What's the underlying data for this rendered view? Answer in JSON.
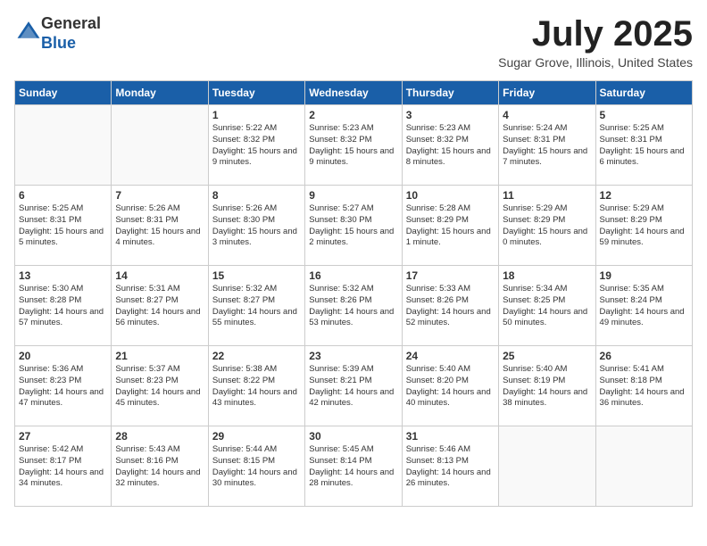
{
  "logo": {
    "line1": "General",
    "line2": "Blue"
  },
  "title": "July 2025",
  "location": "Sugar Grove, Illinois, United States",
  "weekdays": [
    "Sunday",
    "Monday",
    "Tuesday",
    "Wednesday",
    "Thursday",
    "Friday",
    "Saturday"
  ],
  "weeks": [
    [
      {
        "day": "",
        "info": ""
      },
      {
        "day": "",
        "info": ""
      },
      {
        "day": "1",
        "info": "Sunrise: 5:22 AM\nSunset: 8:32 PM\nDaylight: 15 hours and 9 minutes."
      },
      {
        "day": "2",
        "info": "Sunrise: 5:23 AM\nSunset: 8:32 PM\nDaylight: 15 hours and 9 minutes."
      },
      {
        "day": "3",
        "info": "Sunrise: 5:23 AM\nSunset: 8:32 PM\nDaylight: 15 hours and 8 minutes."
      },
      {
        "day": "4",
        "info": "Sunrise: 5:24 AM\nSunset: 8:31 PM\nDaylight: 15 hours and 7 minutes."
      },
      {
        "day": "5",
        "info": "Sunrise: 5:25 AM\nSunset: 8:31 PM\nDaylight: 15 hours and 6 minutes."
      }
    ],
    [
      {
        "day": "6",
        "info": "Sunrise: 5:25 AM\nSunset: 8:31 PM\nDaylight: 15 hours and 5 minutes."
      },
      {
        "day": "7",
        "info": "Sunrise: 5:26 AM\nSunset: 8:31 PM\nDaylight: 15 hours and 4 minutes."
      },
      {
        "day": "8",
        "info": "Sunrise: 5:26 AM\nSunset: 8:30 PM\nDaylight: 15 hours and 3 minutes."
      },
      {
        "day": "9",
        "info": "Sunrise: 5:27 AM\nSunset: 8:30 PM\nDaylight: 15 hours and 2 minutes."
      },
      {
        "day": "10",
        "info": "Sunrise: 5:28 AM\nSunset: 8:29 PM\nDaylight: 15 hours and 1 minute."
      },
      {
        "day": "11",
        "info": "Sunrise: 5:29 AM\nSunset: 8:29 PM\nDaylight: 15 hours and 0 minutes."
      },
      {
        "day": "12",
        "info": "Sunrise: 5:29 AM\nSunset: 8:29 PM\nDaylight: 14 hours and 59 minutes."
      }
    ],
    [
      {
        "day": "13",
        "info": "Sunrise: 5:30 AM\nSunset: 8:28 PM\nDaylight: 14 hours and 57 minutes."
      },
      {
        "day": "14",
        "info": "Sunrise: 5:31 AM\nSunset: 8:27 PM\nDaylight: 14 hours and 56 minutes."
      },
      {
        "day": "15",
        "info": "Sunrise: 5:32 AM\nSunset: 8:27 PM\nDaylight: 14 hours and 55 minutes."
      },
      {
        "day": "16",
        "info": "Sunrise: 5:32 AM\nSunset: 8:26 PM\nDaylight: 14 hours and 53 minutes."
      },
      {
        "day": "17",
        "info": "Sunrise: 5:33 AM\nSunset: 8:26 PM\nDaylight: 14 hours and 52 minutes."
      },
      {
        "day": "18",
        "info": "Sunrise: 5:34 AM\nSunset: 8:25 PM\nDaylight: 14 hours and 50 minutes."
      },
      {
        "day": "19",
        "info": "Sunrise: 5:35 AM\nSunset: 8:24 PM\nDaylight: 14 hours and 49 minutes."
      }
    ],
    [
      {
        "day": "20",
        "info": "Sunrise: 5:36 AM\nSunset: 8:23 PM\nDaylight: 14 hours and 47 minutes."
      },
      {
        "day": "21",
        "info": "Sunrise: 5:37 AM\nSunset: 8:23 PM\nDaylight: 14 hours and 45 minutes."
      },
      {
        "day": "22",
        "info": "Sunrise: 5:38 AM\nSunset: 8:22 PM\nDaylight: 14 hours and 43 minutes."
      },
      {
        "day": "23",
        "info": "Sunrise: 5:39 AM\nSunset: 8:21 PM\nDaylight: 14 hours and 42 minutes."
      },
      {
        "day": "24",
        "info": "Sunrise: 5:40 AM\nSunset: 8:20 PM\nDaylight: 14 hours and 40 minutes."
      },
      {
        "day": "25",
        "info": "Sunrise: 5:40 AM\nSunset: 8:19 PM\nDaylight: 14 hours and 38 minutes."
      },
      {
        "day": "26",
        "info": "Sunrise: 5:41 AM\nSunset: 8:18 PM\nDaylight: 14 hours and 36 minutes."
      }
    ],
    [
      {
        "day": "27",
        "info": "Sunrise: 5:42 AM\nSunset: 8:17 PM\nDaylight: 14 hours and 34 minutes."
      },
      {
        "day": "28",
        "info": "Sunrise: 5:43 AM\nSunset: 8:16 PM\nDaylight: 14 hours and 32 minutes."
      },
      {
        "day": "29",
        "info": "Sunrise: 5:44 AM\nSunset: 8:15 PM\nDaylight: 14 hours and 30 minutes."
      },
      {
        "day": "30",
        "info": "Sunrise: 5:45 AM\nSunset: 8:14 PM\nDaylight: 14 hours and 28 minutes."
      },
      {
        "day": "31",
        "info": "Sunrise: 5:46 AM\nSunset: 8:13 PM\nDaylight: 14 hours and 26 minutes."
      },
      {
        "day": "",
        "info": ""
      },
      {
        "day": "",
        "info": ""
      }
    ]
  ]
}
